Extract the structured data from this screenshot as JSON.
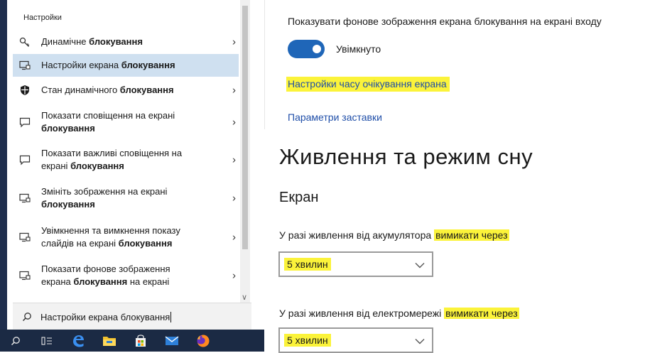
{
  "search_panel": {
    "header": "Настройки",
    "results": [
      {
        "before": "Динамічне ",
        "bold": "блокування",
        "after": "",
        "line2_before": "",
        "line2_bold": "",
        "line2_after": "",
        "icon": "key-icon",
        "selected": false,
        "has_arrow": true
      },
      {
        "before": "Настройки екрана ",
        "bold": "блокування",
        "after": "",
        "line2_before": "",
        "line2_bold": "",
        "line2_after": "",
        "icon": "monitor-lock-icon",
        "selected": true,
        "has_arrow": false
      },
      {
        "before": "Стан динамічного ",
        "bold": "блокування",
        "after": "",
        "line2_before": "",
        "line2_bold": "",
        "line2_after": "",
        "icon": "shield-icon",
        "selected": false,
        "has_arrow": true
      },
      {
        "before": "Показати сповіщення на екрані",
        "bold": "",
        "after": "",
        "line2_before": "",
        "line2_bold": "блокування",
        "line2_after": "",
        "icon": "message-icon",
        "selected": false,
        "has_arrow": true
      },
      {
        "before": "Показати важливі сповіщення на",
        "bold": "",
        "after": "",
        "line2_before": "екрані ",
        "line2_bold": "блокування",
        "line2_after": "",
        "icon": "message-icon",
        "selected": false,
        "has_arrow": true
      },
      {
        "before": "Змініть зображення на екрані",
        "bold": "",
        "after": "",
        "line2_before": "",
        "line2_bold": "блокування",
        "line2_after": "",
        "icon": "monitor-lock-icon",
        "selected": false,
        "has_arrow": true
      },
      {
        "before": "Увімкнення та вимкнення показу",
        "bold": "",
        "after": "",
        "line2_before": "слайдів на екрані ",
        "line2_bold": "блокування",
        "line2_after": "",
        "icon": "monitor-lock-icon",
        "selected": false,
        "has_arrow": true
      },
      {
        "before": "Показати фонове зображення",
        "bold": "",
        "after": "",
        "line2_before": "екрана ",
        "line2_bold": "блокування",
        "line2_after": " на екрані",
        "icon": "monitor-lock-icon",
        "selected": false,
        "has_arrow": true
      }
    ],
    "search_query": "Настройки екрана блокування",
    "taskbar_icons": [
      "search-icon",
      "task-view-icon",
      "edge-icon",
      "file-explorer-icon",
      "store-icon",
      "mail-icon",
      "firefox-icon"
    ]
  },
  "settings": {
    "lock_bg_label": "Показувати фонове зображення екрана блокування на екрані входу",
    "toggle_state": "Увімкнуто",
    "toggle_on": true,
    "timeout_link": "Настройки часу очікування екрана",
    "screensaver_link": "Параметри заставки",
    "power_title": "Живлення та режим сну",
    "screen_subtitle": "Екран",
    "battery_label_start": "У разі живлення від акумулятора ",
    "battery_label_highlight": "вимикати через",
    "battery_value": "5 хвилин",
    "ac_label_start": "У разі живлення від електромережі ",
    "ac_label_highlight": "вимикати через",
    "ac_value": "5 хвилин"
  },
  "colors": {
    "highlight": "#fbf33a",
    "accent_blue": "#1f66b8",
    "link_blue": "#1f4ea8",
    "selected_row": "#cfe0f0",
    "taskbar": "#1b2a44"
  }
}
